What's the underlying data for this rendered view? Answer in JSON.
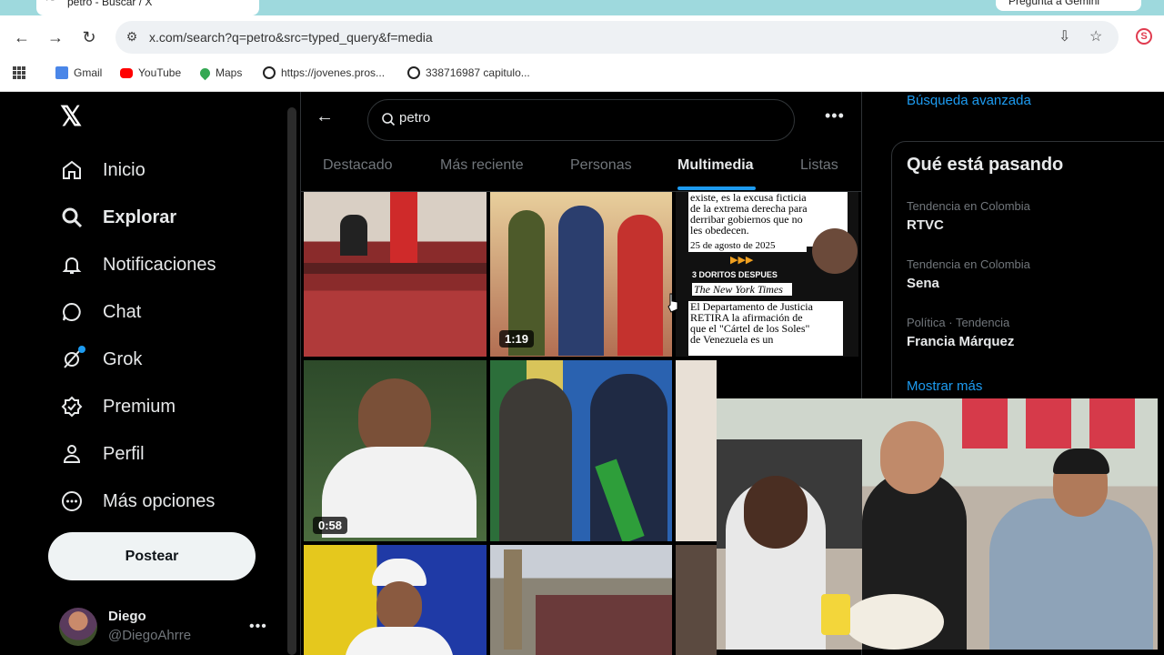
{
  "browser": {
    "tab_title": "petro - Buscar / X",
    "ask_pill": "Pregunta a Gemini",
    "url": "x.com/search?q=petro&src=typed_query&f=media",
    "bookmarks": [
      {
        "label": "Gmail",
        "icon": "gmail-icon"
      },
      {
        "label": "YouTube",
        "icon": "youtube-icon"
      },
      {
        "label": "Maps",
        "icon": "maps-icon"
      },
      {
        "label": "https://jovenes.pros...",
        "icon": "globe-icon"
      },
      {
        "label": "338716987 capitulo...",
        "icon": "globe-icon"
      }
    ]
  },
  "sidebar": {
    "items": [
      {
        "label": "Inicio",
        "icon": "home-icon"
      },
      {
        "label": "Explorar",
        "icon": "search-icon"
      },
      {
        "label": "Notificaciones",
        "icon": "bell-icon"
      },
      {
        "label": "Chat",
        "icon": "chat-icon"
      },
      {
        "label": "Grok",
        "icon": "grok-icon"
      },
      {
        "label": "Premium",
        "icon": "verified-icon"
      },
      {
        "label": "Perfil",
        "icon": "person-icon"
      },
      {
        "label": "Más opciones",
        "icon": "more-circle-icon"
      }
    ],
    "post_button": "Postear",
    "user": {
      "name": "Diego",
      "handle": "@DiegoAhrre"
    }
  },
  "main": {
    "search_value": "petro",
    "tabs": [
      "Destacado",
      "Más reciente",
      "Personas",
      "Multimedia",
      "Listas"
    ],
    "active_tab": "Multimedia",
    "media": [
      {
        "kind": "image",
        "desc": "meeting"
      },
      {
        "kind": "video",
        "duration": "1:19"
      },
      {
        "kind": "image",
        "desc": "newspaper"
      },
      {
        "kind": "video",
        "duration": "0:58"
      },
      {
        "kind": "image",
        "desc": "handshake"
      },
      {
        "kind": "image",
        "desc": "partial"
      },
      {
        "kind": "image",
        "desc": "portrait"
      },
      {
        "kind": "image",
        "desc": "plaza"
      },
      {
        "kind": "image",
        "desc": "partial"
      }
    ],
    "newspaper_text": {
      "line1": "existe, es la excusa ficticia",
      "line2": "de la extrema derecha para",
      "line3": "derribar gobiernos que no",
      "line4": "les obedecen.",
      "date": "25 de agosto de 2025",
      "after": "3 DORITOS DESPUES",
      "paper": "The New York Times",
      "body1": "El Departamento de Justicia",
      "body2": "RETIRA la afirmación de",
      "body3": "que el \"Cártel de los Soles\"",
      "body4": "de Venezuela es un"
    }
  },
  "right": {
    "advanced_search": "Búsqueda avanzada",
    "trend_title": "Qué está pasando",
    "trends": [
      {
        "context": "Tendencia en Colombia",
        "name": "RTVC"
      },
      {
        "context": "Tendencia en Colombia",
        "name": "Sena"
      },
      {
        "context": "Política · Tendencia",
        "name": "Francia Márquez"
      }
    ],
    "show_more": "Mostrar más"
  },
  "colors": {
    "accent": "#1d9bf0",
    "background": "#000000",
    "text": "#e7e9ea",
    "muted": "#71767b"
  }
}
